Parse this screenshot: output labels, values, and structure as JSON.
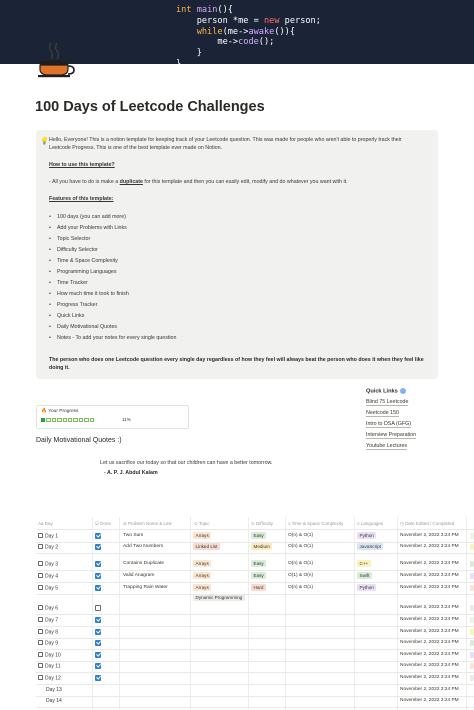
{
  "cover": {
    "code_lines": [
      "int main(){",
      "    person *me = new person;",
      "    while(me->awake()){",
      "        me->code();",
      "    }",
      "}"
    ]
  },
  "page": {
    "icon": "coffee-cup-icon",
    "title": "100 Days of Leetcode Challenges"
  },
  "callout": {
    "icon": "bulb-icon",
    "intro_line1": "Hello, Everyone! This is a notion template for keeping track of your Leetcode question. This was made for people who aren't able to properly track their",
    "intro_line2": "Leetcode Progress. This is one of the best template ever made on Notion.",
    "how_heading": "How to use this template?",
    "how_prefix": "- All you have to do is make a ",
    "how_link": "duplicate",
    "how_suffix": " for this template and then you can easily edit, modify and do whatever you want with it.",
    "features_heading": "Features of this template:",
    "features": [
      "100 days (you can add more)",
      "Add your Problems with Links",
      "Topic Selector",
      "Difficulty Selector",
      "Time & Space Complexity",
      "Programming Languages",
      "Time Tracker",
      "How much time it took to finish",
      "Progress Tracker",
      "Quick Links",
      "Daily Motivational Quotes",
      "Notes - To add your notes for every single question"
    ],
    "closing": "The person who does one Leetcode question every single day regardless of how they feel will always beat the person who does it when they feel like doing it."
  },
  "progress": {
    "label": "Your Progress",
    "icon": "fire-icon",
    "fraction": 0.11,
    "percent_text": "11%"
  },
  "quick_links": {
    "heading": "Quick Links",
    "items": [
      "Blind 75 Leetcode",
      "Neetcode 150",
      "Intro to DSA (GFG)",
      "Interview Preparation",
      "Youtube Lectures"
    ]
  },
  "quotes": {
    "heading": "Daily Motivational Quotes :)",
    "text": "Let us sacrifice our today so that our children can have a better tomorrow.",
    "author": "- A. P. J. Abdul Kalam"
  },
  "table": {
    "columns": [
      "Aa Day",
      "Done",
      "Problem Name & Link",
      "Topic",
      "Difficulty",
      "Time & Space Complexity",
      "Languages",
      "Date Edited / Completed"
    ],
    "rows": [
      {
        "day": "Day 1",
        "done": true,
        "name": "Two Sum",
        "topic": "Arrays",
        "topic2": "",
        "difficulty": "Easy",
        "complexity": "O(n) & O(1)",
        "language": "Python",
        "date": "November 2, 2022 3:24 PM"
      },
      {
        "day": "Day 2",
        "done": true,
        "name": "Add Two Numbers",
        "topic": "Linked List",
        "topic2": "",
        "difficulty": "Medium",
        "complexity": "O(n) & O(1)",
        "language": "JavaScript",
        "date": "November 2, 2022 3:24 PM"
      },
      {
        "day": "Day 3",
        "done": true,
        "name": "Contains Duplicate",
        "topic": "Arrays",
        "topic2": "",
        "difficulty": "Easy",
        "complexity": "O(n) & O(1)",
        "language": "C++",
        "date": "November 2, 2022 3:24 PM"
      },
      {
        "day": "Day 4",
        "done": true,
        "name": "Valid Anagram",
        "topic": "Arrays",
        "topic2": "",
        "difficulty": "Easy",
        "complexity": "O(1) & O(n)",
        "language": "Swift",
        "date": "November 2, 2022 3:24 PM"
      },
      {
        "day": "Day 5",
        "done": true,
        "name": "Trapping Rain Water",
        "topic": "Arrays",
        "topic2": "Dynamic Programming",
        "difficulty": "Hard",
        "complexity": "O(n) & O(1)",
        "language": "Python",
        "date": "November 2, 2022 3:24 PM"
      },
      {
        "day": "Day 6",
        "done": false,
        "name": "",
        "topic": "",
        "topic2": "",
        "difficulty": "",
        "complexity": "",
        "language": "",
        "date": "November 2, 2022 3:24 PM"
      },
      {
        "day": "Day 7",
        "done": true,
        "name": "",
        "topic": "",
        "topic2": "",
        "difficulty": "",
        "complexity": "",
        "language": "",
        "date": "November 2, 2022 3:24 PM"
      },
      {
        "day": "Day 8",
        "done": true,
        "name": "",
        "topic": "",
        "topic2": "",
        "difficulty": "",
        "complexity": "",
        "language": "",
        "date": "November 2, 2022 3:24 PM"
      },
      {
        "day": "Day 9",
        "done": true,
        "name": "",
        "topic": "",
        "topic2": "",
        "difficulty": "",
        "complexity": "",
        "language": "",
        "date": "November 2, 2022 3:24 PM"
      },
      {
        "day": "Day 10",
        "done": true,
        "name": "",
        "topic": "",
        "topic2": "",
        "difficulty": "",
        "complexity": "",
        "language": "",
        "date": "November 2, 2022 3:24 PM"
      },
      {
        "day": "Day 11",
        "done": true,
        "name": "",
        "topic": "",
        "topic2": "",
        "difficulty": "",
        "complexity": "",
        "language": "",
        "date": "November 2, 2022 3:24 PM"
      },
      {
        "day": "Day 12",
        "done": true,
        "name": "",
        "topic": "",
        "topic2": "",
        "difficulty": "",
        "complexity": "",
        "language": "",
        "date": "November 2, 2022 3:24 PM"
      },
      {
        "day": "Day 13",
        "done": null,
        "name": "",
        "topic": "",
        "topic2": "",
        "difficulty": "",
        "complexity": "",
        "language": "",
        "date": "November 2, 2022 3:24 PM"
      },
      {
        "day": "Day 14",
        "done": null,
        "name": "",
        "topic": "",
        "topic2": "",
        "difficulty": "",
        "complexity": "",
        "language": "",
        "date": "November 2, 2022 3:24 PM"
      }
    ]
  },
  "colors": {
    "cover_bg": "#1b2436",
    "callout_bg": "#f1f1ef",
    "checkbox_on": "#2f80d1",
    "topic_arrays": "#fbe5cf",
    "topic_linked": "#f8dad2",
    "topic_dp": "#eceae8",
    "easy": "#d7ecd9",
    "medium": "#fdeac2",
    "hard": "#f8dad2",
    "python": "#e8def6",
    "javascript": "#d8e6f6",
    "cpp": "#fbf2bc",
    "swift": "#d7ecd9"
  }
}
